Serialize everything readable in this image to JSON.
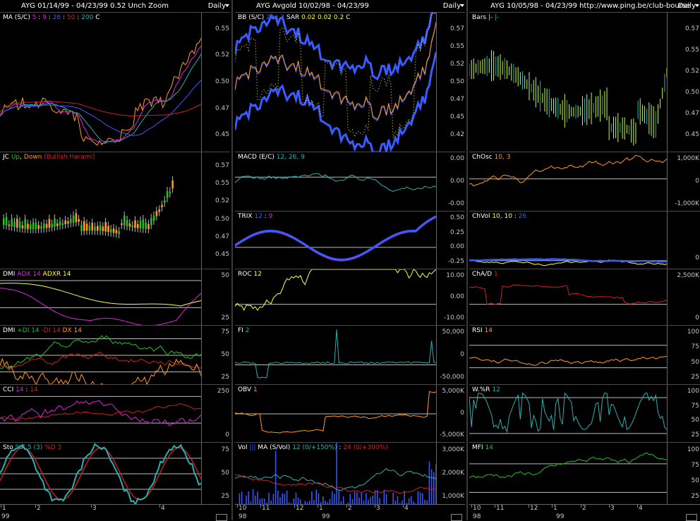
{
  "colors": {
    "bg": "#000000",
    "grid": "#c0c0c0",
    "yellow": "#ffff40",
    "orange": "#ff9a20",
    "blue": "#3a5bff",
    "red": "#d02020",
    "cyan": "#2ab0b0",
    "magenta": "#e020e0",
    "green": "#20c020",
    "white": "#ffffff",
    "lime": "#c0ff40"
  },
  "columns": [
    {
      "title": "AYG  01/14/99 - 04/23/99   0.52  Unch   Zoom",
      "period": "Daily",
      "x_top": [
        "1",
        "2",
        "3",
        "4"
      ],
      "x_bottom": [
        "99"
      ],
      "panes": [
        {
          "id": "ma",
          "label": [
            {
              "t": "MA (S/C) ",
              "c": "#ffffff"
            },
            {
              "t": "5",
              "c": "#e020e0"
            },
            {
              "t": " : ",
              "c": "#ffffff"
            },
            {
              "t": "9",
              "c": "#e020e0"
            },
            {
              "t": " : ",
              "c": "#ffffff"
            },
            {
              "t": "26",
              "c": "#3a5bff"
            },
            {
              "t": " : ",
              "c": "#ffffff"
            },
            {
              "t": "50",
              "c": "#d02020"
            },
            {
              "t": " : ",
              "c": "#ffffff"
            },
            {
              "t": "200",
              "c": "#2ab0b0"
            },
            {
              "t": "   C ",
              "c": "#ffffff"
            }
          ],
          "ticks": [
            "0.55",
            "0.52",
            "0.50",
            "0.47",
            "0.45"
          ]
        },
        {
          "id": "jc",
          "label": [
            {
              "t": "JC ",
              "c": "#ffffff"
            },
            {
              "t": "Up",
              "c": "#20c020"
            },
            {
              "t": ", ",
              "c": "#ffffff"
            },
            {
              "t": "Down",
              "c": "#ff9a20"
            },
            {
              "t": " (Bullish Harami)",
              "c": "#d02020"
            }
          ],
          "ticks": [
            "0.57",
            "0.55",
            "0.52",
            "0.50",
            "0.47",
            "0.45"
          ]
        },
        {
          "id": "dmi1",
          "label": [
            {
              "t": "DMI ",
              "c": "#ffffff"
            },
            {
              "t": "ADX 14",
              "c": "#e020e0"
            },
            {
              "t": " ",
              "c": "#ffffff"
            },
            {
              "t": "ADXR 14",
              "c": "#ffff40"
            }
          ],
          "ticks": [
            "50",
            "25"
          ]
        },
        {
          "id": "dmi2",
          "label": [
            {
              "t": "DMI ",
              "c": "#ffffff"
            },
            {
              "t": "+DI 14",
              "c": "#20c020"
            },
            {
              "t": " ",
              "c": "#ffffff"
            },
            {
              "t": "-DI 14",
              "c": "#d02020"
            },
            {
              "t": " ",
              "c": "#ffffff"
            },
            {
              "t": "DX 14",
              "c": "#ff9a20"
            }
          ],
          "ticks": [
            "75",
            "50",
            "25"
          ]
        },
        {
          "id": "cci",
          "label": [
            {
              "t": "CCI ",
              "c": "#ffffff"
            },
            {
              "t": "14",
              "c": "#e020e0"
            },
            {
              "t": " : ",
              "c": "#ffffff"
            },
            {
              "t": "14",
              "c": "#d02020"
            }
          ],
          "ticks": [
            "250",
            "0"
          ]
        },
        {
          "id": "sto",
          "label": [
            {
              "t": "Sto ",
              "c": "#ffffff"
            },
            {
              "t": "%K 5 (3)",
              "c": "#2ab0b0"
            },
            {
              "t": " ",
              "c": "#ffffff"
            },
            {
              "t": "%D 3",
              "c": "#d02020"
            }
          ],
          "ticks": [
            "75",
            "50",
            "25"
          ]
        }
      ]
    },
    {
      "title": "AYG   Avgold   10/02/98 - 04/23/99",
      "period": "Daily",
      "x_top": [
        "10",
        "11",
        "12",
        "1",
        "2",
        "3",
        "4"
      ],
      "x_bottom": [
        "98",
        "99"
      ],
      "panes": [
        {
          "id": "bb",
          "label": [
            {
              "t": "BB (S/C) ",
              "c": "#ffffff"
            },
            {
              "t": "20",
              "c": "#3a5bff"
            },
            {
              "t": " : ",
              "c": "#ffffff"
            },
            {
              "t": "2",
              "c": "#3a5bff"
            },
            {
              "t": "   SAR  ",
              "c": "#ffffff"
            },
            {
              "t": "0.02  0.02  0.2",
              "c": "#ffff40"
            },
            {
              "t": "   C ",
              "c": "#ffffff"
            }
          ],
          "ticks": [
            "0.57",
            "0.55",
            "0.52",
            "0.50",
            "0.47",
            "0.45",
            "0.42"
          ]
        },
        {
          "id": "macd",
          "label": [
            {
              "t": "MACD (E/C) ",
              "c": "#ffffff"
            },
            {
              "t": "12, 26, 9",
              "c": "#2ab0b0"
            }
          ],
          "ticks": [
            "0.00",
            "0.00",
            "-0.00"
          ]
        },
        {
          "id": "trix",
          "label": [
            {
              "t": "TRIX ",
              "c": "#ffffff"
            },
            {
              "t": "12",
              "c": "#3a5bff"
            },
            {
              "t": " : ",
              "c": "#ffffff"
            },
            {
              "t": "9",
              "c": "#e020e0"
            }
          ],
          "ticks": [
            "0.50",
            "0.25",
            "0.00",
            "-0.25"
          ]
        },
        {
          "id": "roc",
          "label": [
            {
              "t": "ROC ",
              "c": "#ffffff"
            },
            {
              "t": "12",
              "c": "#ffff40"
            }
          ],
          "ticks": [
            "10.00",
            "0.00",
            "-10.00"
          ]
        },
        {
          "id": "fi",
          "label": [
            {
              "t": "FI ",
              "c": "#ffffff"
            },
            {
              "t": "2",
              "c": "#2ab0b0"
            }
          ],
          "ticks": [
            "50,000",
            "0",
            "-50,000"
          ]
        },
        {
          "id": "obv",
          "label": [
            {
              "t": "OBV ",
              "c": "#ffffff"
            },
            {
              "t": "1",
              "c": "#ff9a20"
            }
          ],
          "ticks": [
            "5,000K",
            "0",
            "-5,000K"
          ]
        },
        {
          "id": "vol",
          "label": [
            {
              "t": "Vol ",
              "c": "#ffffff"
            },
            {
              "t": "|||",
              "c": "#3a5bff"
            },
            {
              "t": "   MA (S/Vol) ",
              "c": "#ffffff"
            },
            {
              "t": "12 (0/+150%)",
              "c": "#2ab0b0"
            },
            {
              "t": " : ",
              "c": "#ffffff"
            },
            {
              "t": "24 (0/+300%)",
              "c": "#d02020"
            }
          ],
          "ticks": [
            "3,000K",
            "2,000K",
            "1,000K"
          ]
        }
      ]
    },
    {
      "title": "AYG  10/05/98 - 04/23/99   http://www.ping.be/club-bourse",
      "period": "Daily",
      "x_top": [
        "10",
        "11",
        "12",
        "1",
        "2",
        "3",
        "4"
      ],
      "x_bottom": [
        "98",
        "99"
      ],
      "panes": [
        {
          "id": "bars",
          "label": [
            {
              "t": "Bars ",
              "c": "#ffffff"
            },
            {
              "t": "|-",
              "c": "#c0ff40"
            },
            {
              "t": "  ",
              "c": "#ffffff"
            },
            {
              "t": "|-",
              "c": "#2ab0b0"
            }
          ],
          "ticks": [
            "0.57",
            "0.55",
            "0.52",
            "0.50",
            "0.47",
            "0.45"
          ]
        },
        {
          "id": "chosc",
          "label": [
            {
              "t": "ChOsc ",
              "c": "#ffffff"
            },
            {
              "t": "10, 3",
              "c": "#ff9a20"
            }
          ],
          "ticks": [
            "1,000K",
            "0",
            "-1,000K"
          ]
        },
        {
          "id": "chvol",
          "label": [
            {
              "t": "ChVol ",
              "c": "#ffffff"
            },
            {
              "t": "10, 10",
              "c": "#ffff40"
            },
            {
              "t": " : ",
              "c": "#ffffff"
            },
            {
              "t": "26",
              "c": "#3a5bff"
            }
          ],
          "ticks": [
            "0"
          ]
        },
        {
          "id": "chad",
          "label": [
            {
              "t": "ChA/D ",
              "c": "#ffffff"
            },
            {
              "t": "1",
              "c": "#d02020"
            }
          ],
          "ticks": [
            "2,500K",
            "0"
          ]
        },
        {
          "id": "rsi",
          "label": [
            {
              "t": "RSI ",
              "c": "#ffffff"
            },
            {
              "t": "14",
              "c": "#ff9a20"
            }
          ],
          "ticks": [
            "100",
            "75",
            "50",
            "25"
          ]
        },
        {
          "id": "wr",
          "label": [
            {
              "t": "W.%R ",
              "c": "#ffffff"
            },
            {
              "t": "12",
              "c": "#2ab0b0"
            }
          ],
          "ticks": [
            "100",
            "75",
            "50",
            "25"
          ]
        },
        {
          "id": "mfi",
          "label": [
            {
              "t": "MFI ",
              "c": "#ffffff"
            },
            {
              "t": "14",
              "c": "#20c020"
            }
          ],
          "ticks": [
            "100",
            "75",
            "50",
            "25"
          ]
        }
      ]
    }
  ]
}
